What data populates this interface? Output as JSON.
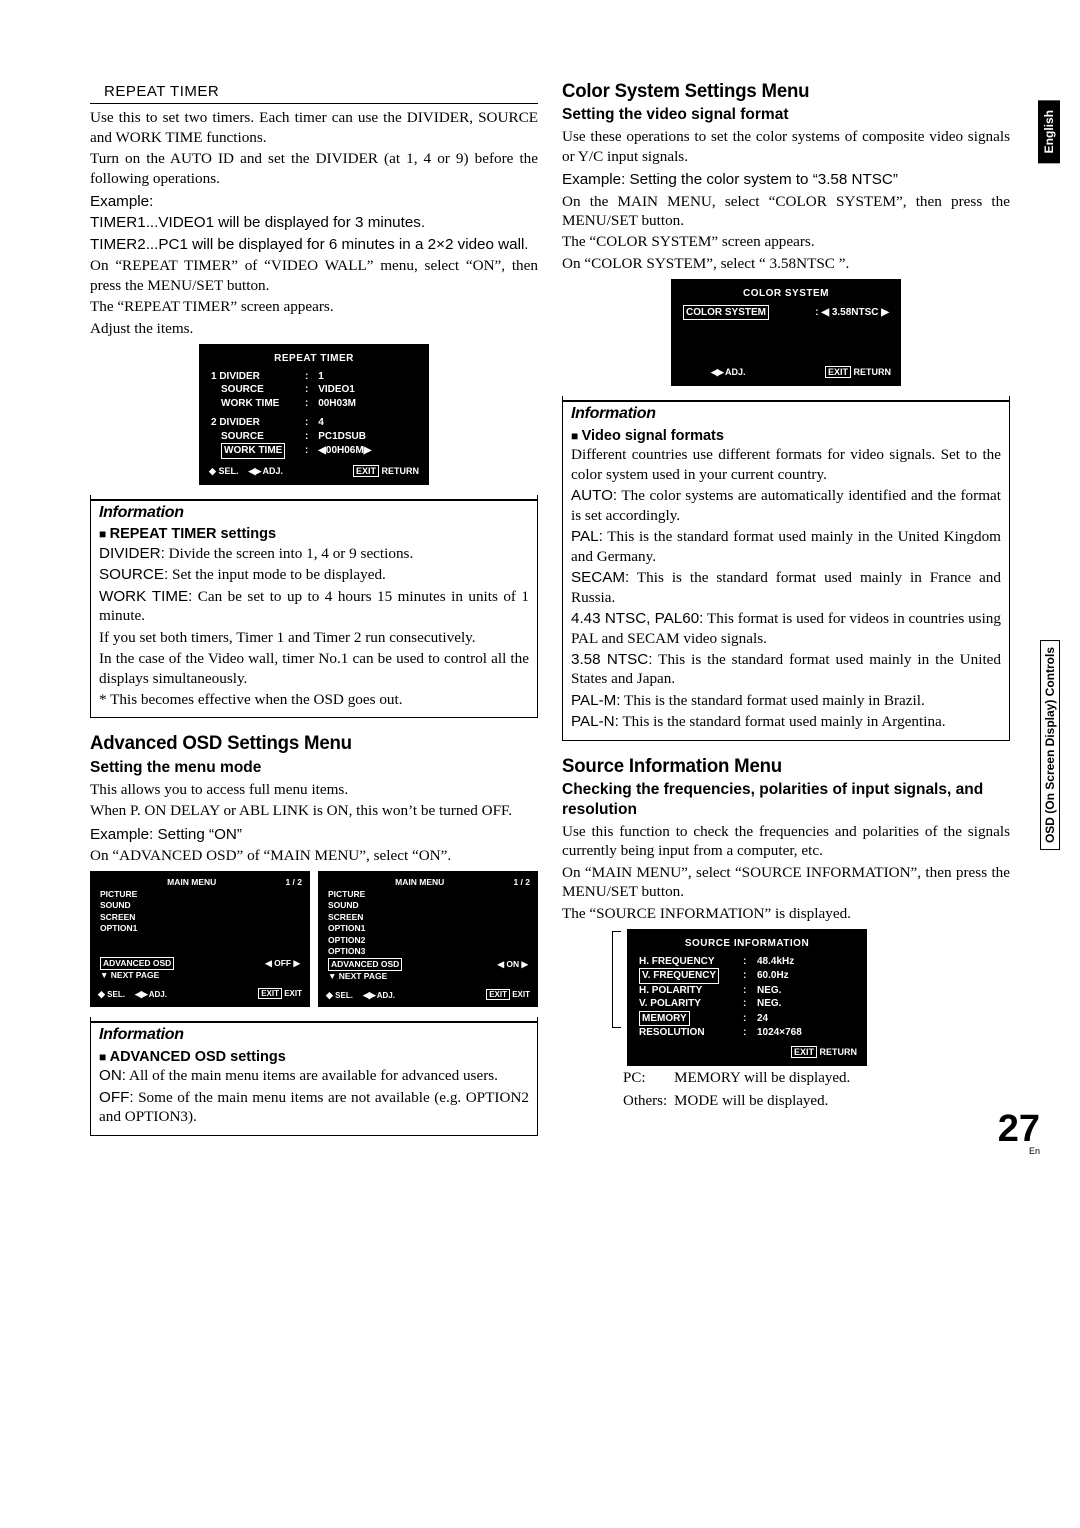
{
  "side": {
    "lang": "English",
    "label": "OSD (On Screen Display) Controls"
  },
  "repeat": {
    "heading": "REPEAT TIMER",
    "p1": "Use this to set two timers. Each timer can use the DIVIDER, SOURCE and WORK TIME functions.",
    "p2": "Turn on the AUTO ID and set the DIVIDER (at 1, 4 or 9) before the following operations.",
    "example": "Example:",
    "ex1": "TIMER1...VIDEO1 will be displayed for 3 minutes.",
    "ex2": "TIMER2...PC1 will be displayed for 6 minutes in a 2×2 video wall.",
    "p3": "On “REPEAT TIMER” of “VIDEO WALL” menu, select “ON”, then press the MENU/SET button.",
    "p4": "The “REPEAT TIMER” screen appears.",
    "p5": "Adjust the items.",
    "osd_title": "REPEAT TIMER",
    "row1a": [
      "1  DIVIDER",
      ":",
      "1"
    ],
    "row1b": [
      "SOURCE",
      ":",
      "VIDEO1"
    ],
    "row1c": [
      "WORK TIME",
      ":",
      "00H03M"
    ],
    "row2a": [
      "2  DIVIDER",
      ":",
      "4"
    ],
    "row2b": [
      "SOURCE",
      ":",
      "PC1DSUB"
    ],
    "row2c": [
      "WORK TIME",
      ":",
      "◀00H06M▶"
    ],
    "sel": "SEL.",
    "adj": "ADJ.",
    "exit": "EXIT",
    "return": "RETURN",
    "info_title": "Information",
    "info_sub": "REPEAT TIMER settings",
    "i_divider": "DIVIDER:",
    "i_divider_t": " Divide the screen into 1, 4 or 9 sections.",
    "i_source": "SOURCE:",
    "i_source_t": " Set the input mode to be displayed.",
    "i_work": "WORK TIME:",
    "i_work_t": " Can be set to up to 4 hours 15 minutes in units of 1 minute.",
    "i_p1": "If you set both timers, Timer 1 and Timer 2 run consecutively.",
    "i_p2": "In the case of the Video wall, timer No.1 can be used to control all the displays simultaneously.",
    "i_note": "*  This becomes effective when the OSD goes out."
  },
  "adv": {
    "title": "Advanced OSD Settings Menu",
    "sub": "Setting the menu mode",
    "p1": "This allows you to access full menu items.",
    "p2": "When P. ON DELAY or ABL LINK is ON, this won’t be turned OFF.",
    "example": "Example: Setting “ON”",
    "p3": "On “ADVANCED OSD” of “MAIN MENU”, select “ON”.",
    "menus": {
      "title": "MAIN MENU",
      "page": "1 / 2",
      "items_off": [
        "PICTURE",
        "SOUND",
        "SCREEN",
        "OPTION1"
      ],
      "items_on": [
        "PICTURE",
        "SOUND",
        "SCREEN",
        "OPTION1",
        "OPTION2",
        "OPTION3"
      ],
      "advanced": "ADVANCED OSD",
      "val_off": "◀ OFF ▶",
      "val_on": "◀ ON ▶",
      "next": "NEXT PAGE",
      "sel": "SEL.",
      "adj": "ADJ.",
      "exit": "EXIT",
      "exit2": "EXIT"
    },
    "info_title": "Information",
    "info_sub": "ADVANCED OSD settings",
    "on": "ON:",
    "on_t": " All of the main menu items are available for advanced users.",
    "off": "OFF:",
    "off_t": " Some of the main menu items are not available (e.g. OPTION2 and OPTION3)."
  },
  "color": {
    "title": "Color System Settings Menu",
    "sub": "Setting the video signal format",
    "p1": "Use these operations to set the color systems of composite video signals or Y/C input signals.",
    "example": "Example: Setting the color system to “3.58 NTSC”",
    "p2": "On the MAIN MENU, select “COLOR SYSTEM”, then press the MENU/SET button.",
    "p3": "The “COLOR SYSTEM” screen appears.",
    "p4": "On “COLOR SYSTEM”, select “ 3.58NTSC ”.",
    "osd_title": "COLOR SYSTEM",
    "item": "COLOR SYSTEM",
    "val": "◀ 3.58NTSC ▶",
    "adj": "ADJ.",
    "exit": "EXIT",
    "return": "RETURN",
    "info_title": "Information",
    "info_sub": "Video signal formats",
    "i_p1": "Different countries use different formats for video signals. Set to the color system used in your current country.",
    "auto": "AUTO:",
    "auto_t": " The color systems are automatically identified and the format is set accordingly.",
    "pal": "PAL:",
    "pal_t": " This is the standard format used mainly in the United Kingdom and Germany.",
    "secam": "SECAM:",
    "secam_t": " This is the standard format used mainly in France and Russia.",
    "n443": "4.43 NTSC, PAL60:",
    "n443_t": " This format is used for videos in countries using PAL and SECAM video signals.",
    "n358": "3.58 NTSC:",
    "n358_t": " This is the standard format used mainly in the United States and Japan.",
    "palm": "PAL-M:",
    "palm_t": " This is the standard format used mainly in Brazil.",
    "paln": "PAL-N:",
    "paln_t": " This is the standard format used mainly in Argentina."
  },
  "source": {
    "title": "Source Information Menu",
    "sub": "Checking the frequencies, polarities of input signals, and resolution",
    "p1": "Use this function to check the frequencies and polarities of the signals currently being input from a computer, etc.",
    "p2": "On “MAIN MENU”, select “SOURCE INFORMATION”, then press the MENU/SET button.",
    "p3": "The “SOURCE INFORMATION” is displayed.",
    "osd_title": "SOURCE INFORMATION",
    "rows": [
      [
        "H. FREQUENCY",
        ":",
        "48.4kHz"
      ],
      [
        "V. FREQUENCY",
        ":",
        "60.0Hz"
      ],
      [
        "",
        "",
        ""
      ],
      [
        "H. POLARITY",
        ":",
        "NEG."
      ],
      [
        "V. POLARITY",
        ":",
        "NEG."
      ],
      [
        "",
        "",
        ""
      ],
      [
        "MEMORY",
        ":",
        "24"
      ],
      [
        "RESOLUTION",
        ":",
        "1024×768"
      ]
    ],
    "exit": "EXIT",
    "return": "RETURN",
    "note1a": "PC:",
    "note1b": "MEMORY will be displayed.",
    "note2a": "Others:",
    "note2b": "MODE will be displayed."
  },
  "page_number": "27",
  "page_lang": "En"
}
